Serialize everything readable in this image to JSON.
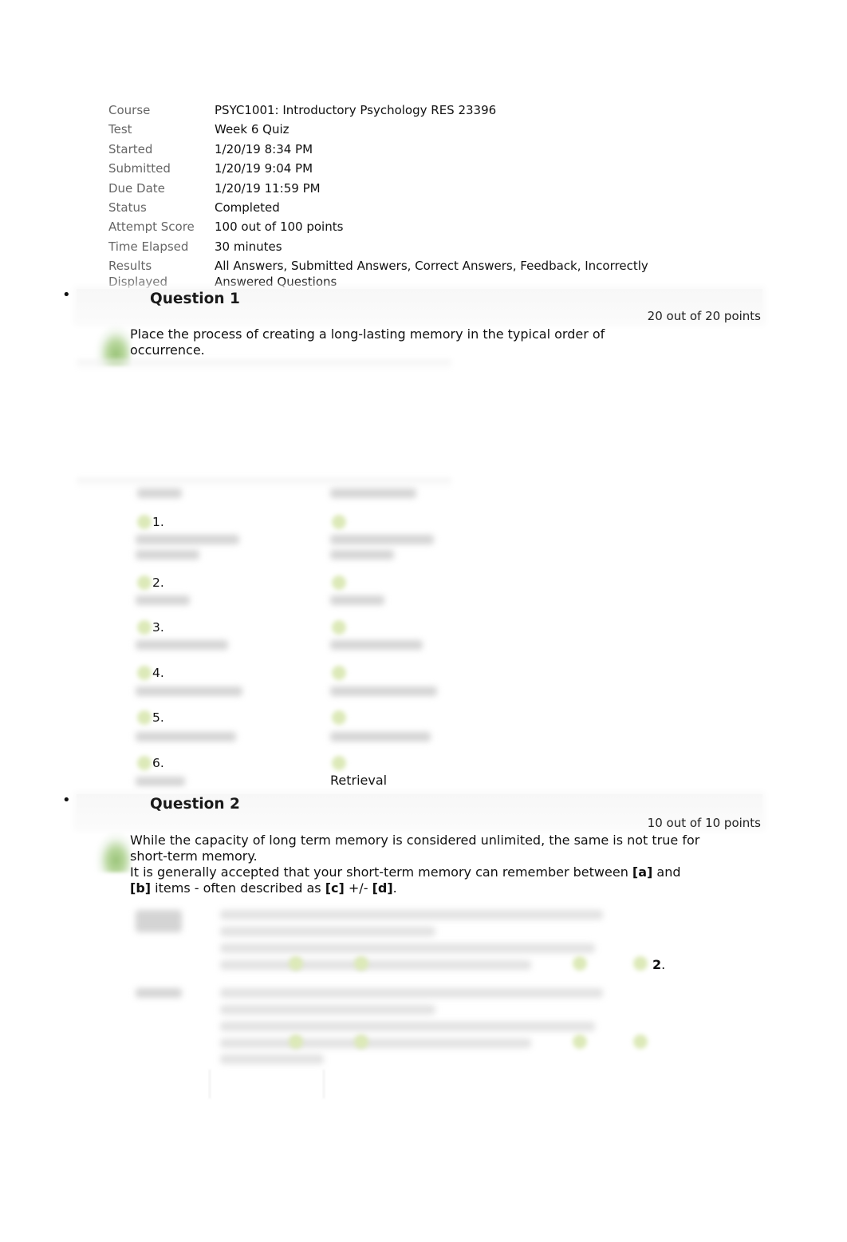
{
  "summary": {
    "rows": [
      {
        "label": "Course",
        "value": "PSYC1001: Introductory Psychology RES 23396"
      },
      {
        "label": "Test",
        "value": "Week 6 Quiz"
      },
      {
        "label": "Started",
        "value": "1/20/19 8:34 PM"
      },
      {
        "label": "Submitted",
        "value": "1/20/19 9:04 PM"
      },
      {
        "label": "Due Date",
        "value": "1/20/19 11:59 PM"
      },
      {
        "label": "Status",
        "value": "Completed"
      },
      {
        "label": "Attempt Score",
        "value": "100 out of 100 points"
      },
      {
        "label": "Time Elapsed",
        "value": "30 minutes"
      },
      {
        "label": "Results Displayed",
        "label_line1": "Results",
        "label_line2": "Displayed",
        "value_line1": "All Answers, Submitted Answers, Correct Answers, Feedback, Incorrectly",
        "value_line2": "Answered Questions"
      }
    ]
  },
  "questions": [
    {
      "bullet": "•",
      "title": "Question 1",
      "points": "20 out of 20 points",
      "status_icon": "correct-check-icon",
      "text": "Place the process of creating a long-lasting memory in the typical order of occurrence.",
      "answer_numbers": [
        "1.",
        "2.",
        "3.",
        "4.",
        "5.",
        "6."
      ],
      "visible_answer": "Retrieval"
    },
    {
      "bullet": "•",
      "title": "Question 2",
      "points": "10 out of 10 points",
      "status_icon": "correct-check-icon",
      "text_line1": "While the capacity of long term memory is considered unlimited, the same is not true for short-term memory.",
      "text_line2_pre": "It is generally accepted that your short-term memory can remember between ",
      "blank_a": "[a]",
      "and": " and ",
      "blank_b": "[b]",
      "mid": " items - often described as ",
      "blank_c": "[c]",
      "plusminus": " +/- ",
      "blank_d": "[d]",
      "end": ".",
      "visible_fragment_bold": "2",
      "visible_fragment_tail": "."
    }
  ],
  "colors": {
    "correct_green": "#9bc47a",
    "label_gray": "#666666",
    "header_bg": "#f7f7f7"
  }
}
